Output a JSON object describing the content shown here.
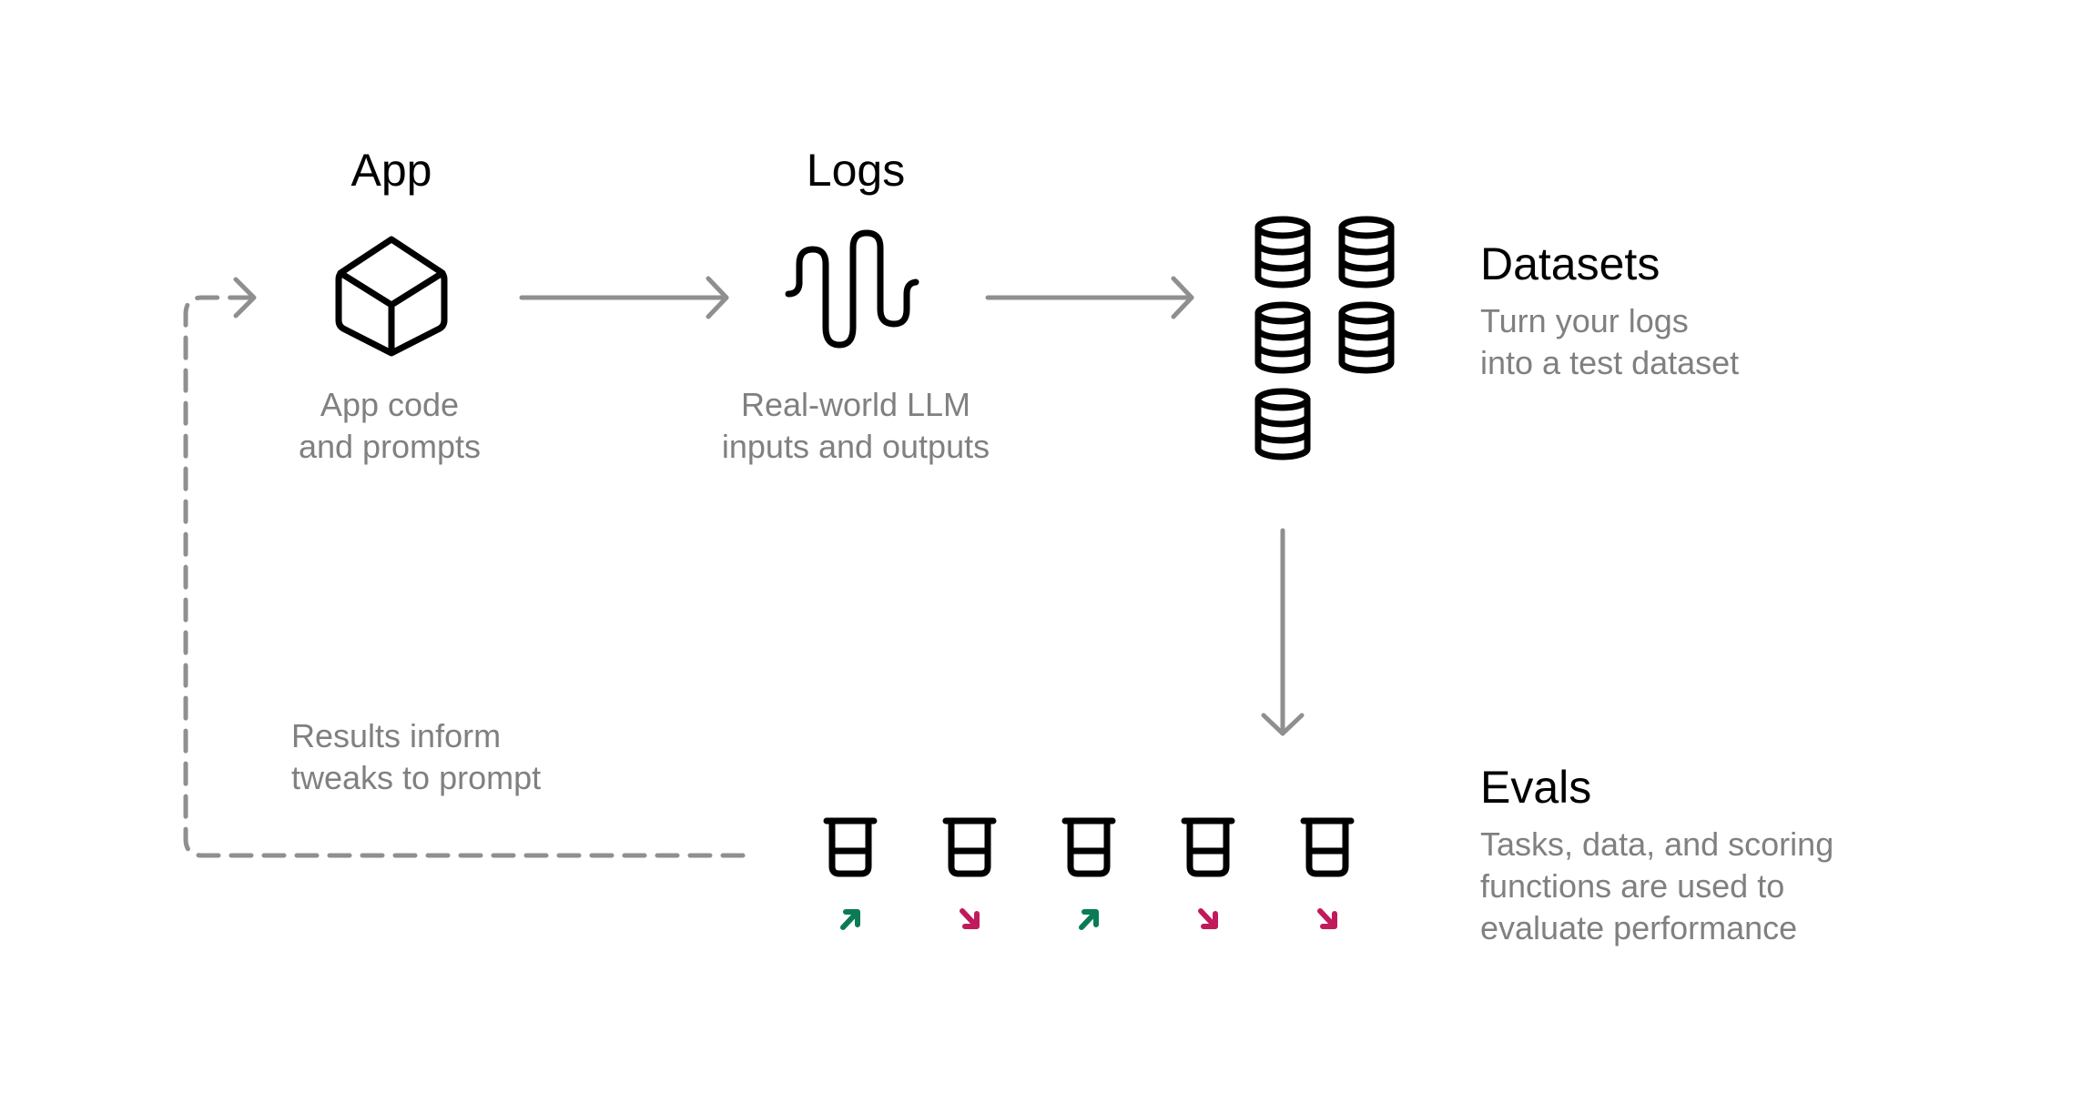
{
  "diagram": {
    "nodes": {
      "app": {
        "title": "App",
        "icon": "cube-icon",
        "description": [
          "App code",
          "and prompts"
        ]
      },
      "logs": {
        "title": "Logs",
        "icon": "waveform-icon",
        "description": [
          "Real-world LLM",
          "inputs and outputs"
        ]
      },
      "datasets": {
        "title": "Datasets",
        "icon": "database-icon",
        "icon_count": 5,
        "description": [
          "Turn your logs",
          "into a test dataset"
        ]
      },
      "evals": {
        "title": "Evals",
        "icon": "beaker-icon",
        "icon_count": 5,
        "description": [
          "Tasks, data, and scoring",
          "functions are used to",
          "evaluate performance"
        ],
        "results": [
          {
            "trend": "up",
            "icon": "arrow-up-right-icon"
          },
          {
            "trend": "down",
            "icon": "arrow-down-right-icon"
          },
          {
            "trend": "up",
            "icon": "arrow-up-right-icon"
          },
          {
            "trend": "down",
            "icon": "arrow-down-right-icon"
          },
          {
            "trend": "down",
            "icon": "arrow-down-right-icon"
          }
        ]
      }
    },
    "edges": [
      {
        "from": "app",
        "to": "logs",
        "style": "solid"
      },
      {
        "from": "logs",
        "to": "datasets",
        "style": "solid"
      },
      {
        "from": "datasets",
        "to": "evals",
        "style": "solid"
      },
      {
        "from": "evals",
        "to": "app",
        "style": "dashed",
        "label": [
          "Results inform",
          "tweaks to prompt"
        ]
      }
    ],
    "colors": {
      "icon_stroke": "#000000",
      "connector": "#8f8f8f",
      "description_text": "#808080",
      "trend_up": "#0b7a55",
      "trend_down": "#c01a5c"
    }
  }
}
